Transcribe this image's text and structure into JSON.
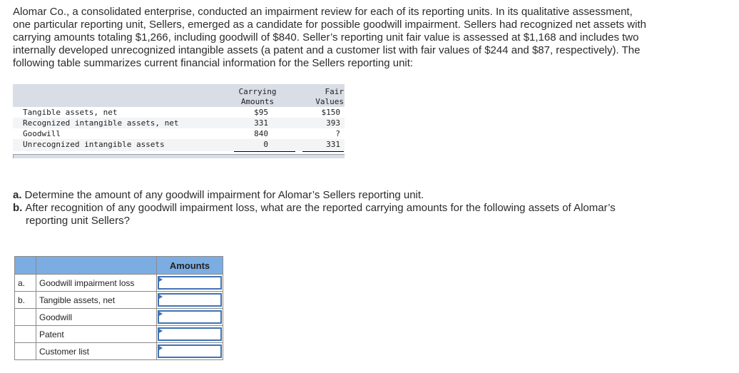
{
  "intro": {
    "lines": [
      "Alomar Co., a consolidated enterprise, conducted an impairment review for each of its reporting units. In its qualitative assessment,",
      "one particular reporting unit, Sellers, emerged as a candidate for possible goodwill impairment. Sellers had recognized net assets with",
      "carrying amounts totaling $1,266, including goodwill of $840. Seller’s reporting unit fair value is assessed at $1,168 and includes two",
      "internally developed unrecognized intangible assets (a patent and a customer list with fair values of $244 and $87, respectively). The",
      "following table summarizes current financial information for the Sellers reporting unit:"
    ]
  },
  "data_table": {
    "headers": {
      "carrying_line1": "Carrying",
      "carrying_line2": "Amounts",
      "fair_line1": "Fair",
      "fair_line2": "Values"
    },
    "rows": [
      {
        "label": "Tangible assets, net",
        "carrying": "$95",
        "fair": "$150"
      },
      {
        "label": "Recognized intangible assets, net",
        "carrying": "331",
        "fair": "393"
      },
      {
        "label": "Goodwill",
        "carrying": "840",
        "fair": "?"
      },
      {
        "label": "Unrecognized intangible assets",
        "carrying": "0",
        "fair": "331"
      }
    ]
  },
  "questions": {
    "a": {
      "letter": "a.",
      "text": "Determine the amount of any goodwill impairment for Alomar’s Sellers reporting unit."
    },
    "b": {
      "letter": "b.",
      "text": "After recognition of any goodwill impairment loss, what are the reported carrying amounts for the following assets of Alomar’s",
      "text_cont": "reporting unit Sellers?"
    }
  },
  "answer_table": {
    "header_amounts": "Amounts",
    "rows": [
      {
        "letter": "a.",
        "label": "Goodwill impairment loss",
        "value": ""
      },
      {
        "letter": "b.",
        "label": "Tangible assets, net",
        "value": ""
      },
      {
        "letter": "",
        "label": "Goodwill",
        "value": ""
      },
      {
        "letter": "",
        "label": "Patent",
        "value": ""
      },
      {
        "letter": "",
        "label": "Customer list",
        "value": ""
      }
    ]
  },
  "colors": {
    "table_header_bg": "#d9dde5",
    "answer_header_bg": "#7bade3",
    "input_border": "#3f73b8"
  }
}
